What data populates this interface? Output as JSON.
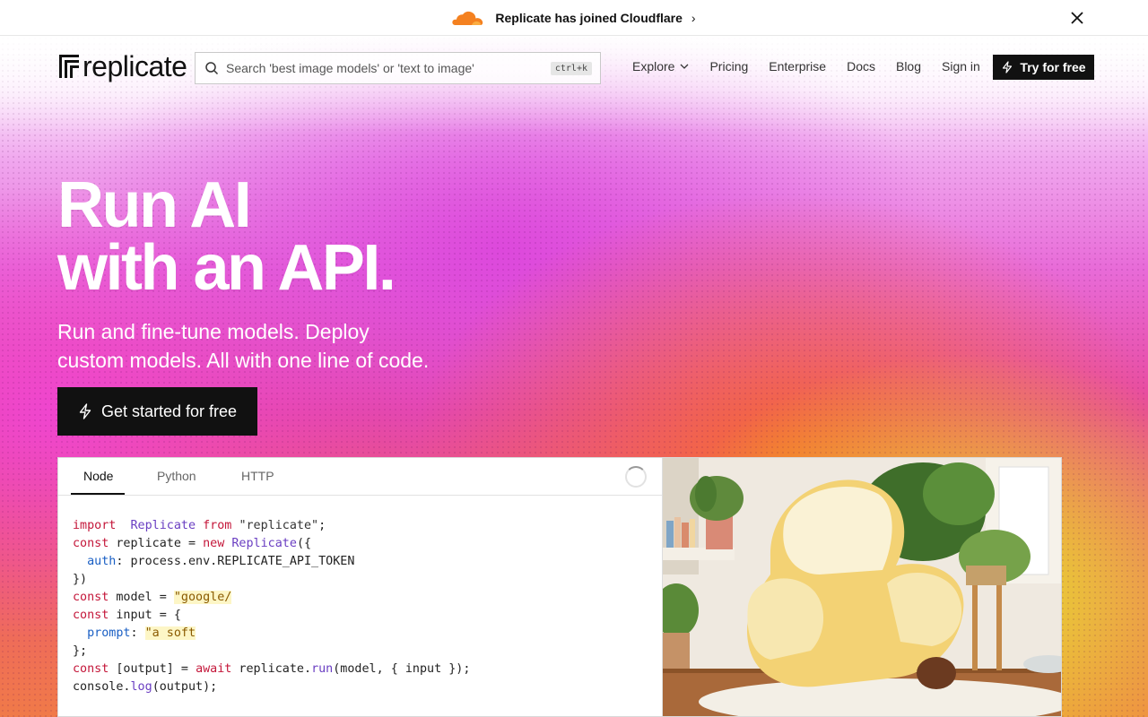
{
  "announcement": {
    "text": "Replicate has joined Cloudflare",
    "chevron": "›"
  },
  "nav": {
    "logo_text": "replicate",
    "search_placeholder": "Search 'best image models' or 'text to image'",
    "search_shortcut": "ctrl+k",
    "links": [
      "Explore",
      "Pricing",
      "Enterprise",
      "Docs",
      "Blog",
      "Sign in"
    ],
    "try_button": "Try for free"
  },
  "hero": {
    "headline_line1": "Run AI",
    "headline_line2": "with an API.",
    "subhead_line1": "Run and fine-tune models. Deploy",
    "subhead_line2": "custom models. All with one line of code.",
    "cta": "Get started for free"
  },
  "code_panel": {
    "tabs": [
      "Node",
      "Python",
      "HTTP"
    ],
    "active_tab": "Node",
    "lines": [
      {
        "t": [
          [
            "kw",
            "import"
          ],
          [
            "",
            "  "
          ],
          [
            "cls",
            "Replicate"
          ],
          [
            "",
            " "
          ],
          [
            "kw",
            "from"
          ],
          [
            "",
            " "
          ],
          [
            "str",
            "\"replicate\""
          ],
          [
            "",
            ";"
          ]
        ]
      },
      {
        "t": [
          [
            "kw",
            "const"
          ],
          [
            "",
            " replicate = "
          ],
          [
            "kw",
            "new"
          ],
          [
            "",
            " "
          ],
          [
            "cls",
            "Replicate"
          ],
          [
            "",
            "({"
          ]
        ]
      },
      {
        "t": [
          [
            "",
            "  "
          ],
          [
            "prop",
            "auth"
          ],
          [
            "",
            ": process.env.REPLICATE_API_TOKEN"
          ]
        ]
      },
      {
        "t": [
          [
            "",
            "})"
          ]
        ]
      },
      {
        "t": [
          [
            "kw",
            "const"
          ],
          [
            "",
            " model = "
          ],
          [
            "hl",
            "\"google/"
          ]
        ]
      },
      {
        "t": [
          [
            "kw",
            "const"
          ],
          [
            "",
            " input = {"
          ]
        ]
      },
      {
        "t": [
          [
            "",
            "  "
          ],
          [
            "prop",
            "prompt"
          ],
          [
            "",
            ": "
          ],
          [
            "hl",
            "\"a soft"
          ]
        ]
      },
      {
        "t": [
          [
            "",
            "};"
          ]
        ]
      },
      {
        "t": [
          [
            "kw",
            "const"
          ],
          [
            "",
            " [output] = "
          ],
          [
            "kw",
            "await"
          ],
          [
            "",
            " replicate."
          ],
          [
            "fn",
            "run"
          ],
          [
            "",
            "(model, { input });"
          ]
        ]
      },
      {
        "t": [
          [
            "",
            "console."
          ],
          [
            "fn",
            "log"
          ],
          [
            "",
            "(output);"
          ]
        ]
      }
    ]
  },
  "colors": {
    "accent_dark": "#111111",
    "keyword": "#c4173a",
    "class": "#6a3ec2",
    "property": "#1a5fc4",
    "cloudflare_orange": "#f48120"
  }
}
